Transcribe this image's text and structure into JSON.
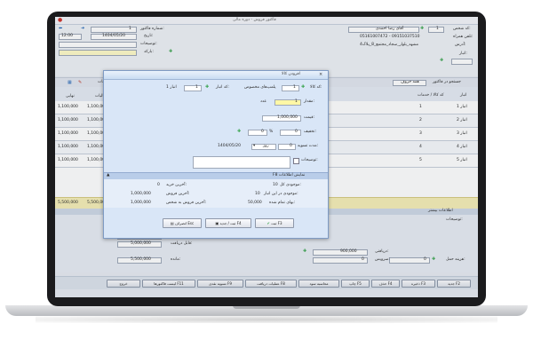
{
  "app": {
    "title": "فاکتور فروش - دوره مالی",
    "customer_code_label": "کد شخص:",
    "customer_code": "1",
    "customer_name_label": "آقای رضا احمدی",
    "phone_label": "تلفن همراه:",
    "phone": "05161007472 - 09151037510",
    "address_label": "آدرس:",
    "address": "مشهد_بلوار_سجاد_مجتمع_8_پلاک4",
    "invoice_no_label": "شماره فاکتور:",
    "invoice_no": "1",
    "date_label": "تاریخ:",
    "date": "1404/05/20",
    "time": "12:00",
    "desc_label": "توضیحات:",
    "barcode_label": "بارکد:"
  },
  "toolbar": {
    "search_label": "جستجو در فاکتور",
    "item_search_label": "همه حروف",
    "tax_label": "تخفیفات",
    "col_amount_label": "مبلغ"
  },
  "table": {
    "headers": [
      "انبار",
      "کد کالا / خدمات",
      "مقدار",
      "فی",
      "تخفیف",
      "مبلغ",
      "خالص",
      "مالیات",
      "نهایی"
    ],
    "rows": [
      {
        "store": "انبار 1",
        "code": "1",
        "qty": "",
        "net": "1,100,000",
        "tax": "1,100,000",
        "final": "1,100,000"
      },
      {
        "store": "انبار 2",
        "code": "2",
        "qty": "",
        "net": "1,100,000",
        "tax": "1,100,000",
        "final": "1,100,000"
      },
      {
        "store": "انبار 3",
        "code": "3",
        "qty": "",
        "net": "1,100,000",
        "tax": "1,100,000",
        "final": "1,100,000"
      },
      {
        "store": "انبار 4",
        "code": "4",
        "qty": "",
        "net": "1,100,000",
        "tax": "1,100,000",
        "final": "1,100,000"
      },
      {
        "store": "انبار 5",
        "code": "5",
        "qty": "",
        "net": "1,100,000",
        "tax": "1,100,000",
        "final": "1,100,000"
      }
    ],
    "total_net": "5,500,000",
    "total_tax": "5,500,000",
    "total_final": "5,500,000"
  },
  "summary": {
    "title": "اطلاعات بیشتر",
    "total_label": "جمع کل:",
    "total": "5,000,000",
    "discount_label": "تخفیف:",
    "discount": "0",
    "pct": "%",
    "tax_label": "مالیات:",
    "tax": "5,000,000",
    "receivable_label": "قابل دریافت:",
    "receivable": "5,000,000",
    "received_label": "دریافتی:",
    "received": "900,000",
    "remaining_label": "مانده:",
    "remaining": "5,500,000",
    "shipping_label": "هزینه حمل:",
    "shipping": "0",
    "notes_label": "توضیحات:",
    "lot_label": "سرویس:",
    "lot": "0"
  },
  "bottom_buttons": [
    "جدید F2",
    "ذخیره F3",
    "حذف F4",
    "چاپ F5",
    "محاسبه سود",
    "عملیات دریافت F8",
    "تسویه نقدی F9",
    "لیست فاکتورها F11",
    "خروج"
  ],
  "dialog": {
    "title": "افزودن کالا",
    "close": "×",
    "item_code_label": "کد کالا:",
    "item_code": "1",
    "item_name": "پلمپ‌های مخصوص",
    "store_code_label": "کد انبار:",
    "store_code": "1",
    "store_name": "انبار 1",
    "qty_label": "مقدار:",
    "qty": "1",
    "unit": "عدد",
    "price_label": "قیمت:",
    "price": "1,000,000",
    "discount_label": "تخفیف:",
    "discount": "0",
    "pct": "%",
    "discount_amount": "0",
    "warranty_label": "مدت تسویه:",
    "warranty": "0",
    "warranty_unit": "روز",
    "warranty_date": "1404/05/20",
    "notes_label": "توضیحات:",
    "info_header": "F8 نمایش اطلاعات",
    "info": {
      "stock_total_label": "موجودی کل:",
      "stock_total": "10",
      "last_buy_label": "آخرین خرید:",
      "last_buy": "0",
      "stock_store_label": "موجودی در این انبار:",
      "stock_store": "10",
      "last_sell_label": "آخرین فروش:",
      "last_sell": "1,000,000",
      "avg_price_label": "بهای تمام شده:",
      "avg_price": "50,000",
      "last_sell_person_label": "آخرین فروش به شخص:",
      "last_sell_person": "1,000,000"
    },
    "btn_add": "ثبت F3",
    "btn_add_new": "ثبت / جدید F4",
    "btn_cancel": "انصراف Esc"
  }
}
